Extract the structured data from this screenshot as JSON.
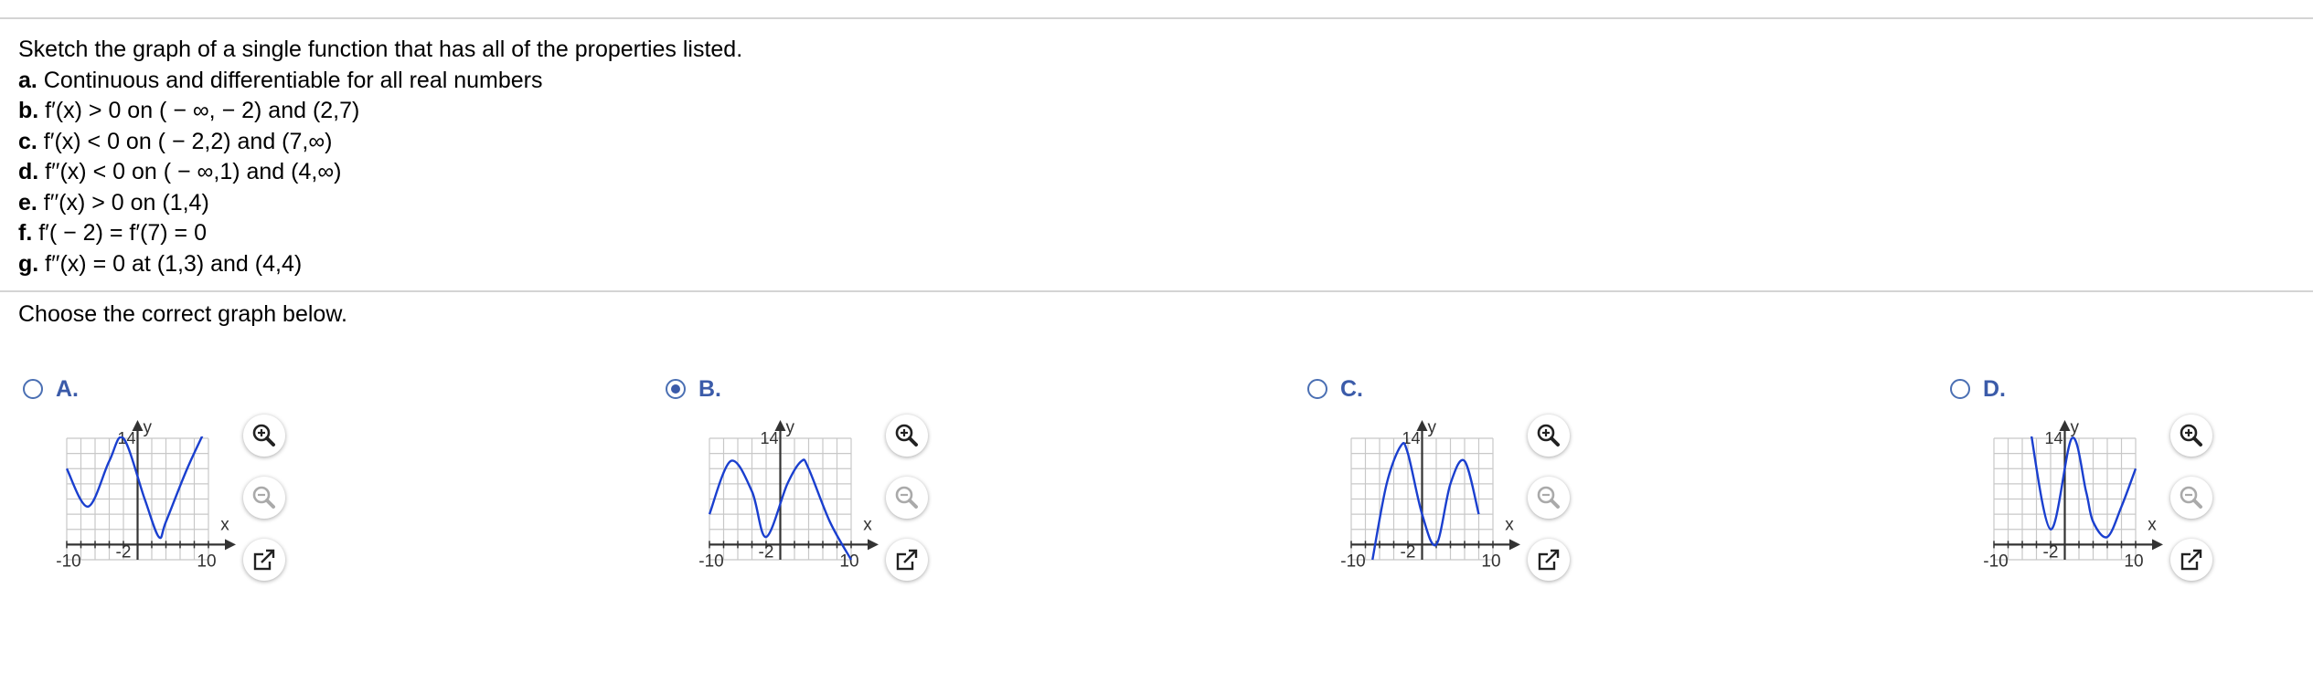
{
  "problem": {
    "intro": "Sketch the graph of a single function that has all of the properties listed.",
    "properties": [
      {
        "label": "a.",
        "text": " Continuous and differentiable for all real numbers"
      },
      {
        "label": "b.",
        "text": " f′(x) > 0 on ( − ∞, − 2) and (2,7)"
      },
      {
        "label": "c.",
        "text": " f′(x) < 0 on ( − 2,2) and (7,∞)"
      },
      {
        "label": "d.",
        "text": " f′′(x) < 0 on ( − ∞,1) and (4,∞)"
      },
      {
        "label": "e.",
        "text": " f′′(x) > 0 on (1,4)"
      },
      {
        "label": "f.",
        "text": " f′( − 2) = f′(7) = 0"
      },
      {
        "label": "g.",
        "text": " f′′(x) = 0 at (1,3) and (4,4)"
      }
    ]
  },
  "prompt": "Choose the correct graph below.",
  "choices": [
    {
      "letter": "A.",
      "selected": false
    },
    {
      "letter": "B.",
      "selected": true
    },
    {
      "letter": "C.",
      "selected": false
    },
    {
      "letter": "D.",
      "selected": false
    }
  ],
  "graph_labels": {
    "y_axis": "y",
    "x_axis": "x",
    "y_max": "14",
    "x_min": "-10",
    "x_tick": "-2",
    "x_max": "10"
  },
  "icons": {
    "zoom_in": "zoom-in-icon",
    "zoom_out": "zoom-out-icon",
    "popout": "popout-icon"
  },
  "colors": {
    "accent": "#3b5ba9",
    "curve": "#1a3fcf",
    "grid": "#c8c8c8"
  },
  "chart_data": [
    {
      "type": "line",
      "choice": "A",
      "xlim": [
        -10,
        10
      ],
      "ylim": [
        -2,
        14
      ],
      "x": [
        -10,
        -7,
        -4,
        -2,
        1,
        3,
        4,
        7,
        10
      ],
      "values": [
        10,
        5,
        11,
        14,
        6,
        1,
        3,
        10,
        16
      ]
    },
    {
      "type": "line",
      "choice": "B",
      "xlim": [
        -10,
        10
      ],
      "ylim": [
        -2,
        14
      ],
      "x": [
        -10,
        -7,
        -4,
        -2,
        1,
        3,
        4,
        7,
        10
      ],
      "values": [
        4,
        11,
        7,
        1,
        8,
        11,
        10,
        3,
        -2
      ]
    },
    {
      "type": "line",
      "choice": "C",
      "xlim": [
        -10,
        10
      ],
      "ylim": [
        -2,
        14
      ],
      "x": [
        -7,
        -5,
        -3,
        -2,
        0,
        2,
        4,
        6,
        8
      ],
      "values": [
        -2,
        8,
        13,
        12,
        4,
        0,
        8,
        11,
        4
      ]
    },
    {
      "type": "line",
      "choice": "D",
      "xlim": [
        -10,
        10
      ],
      "ylim": [
        -2,
        14
      ],
      "x": [
        -5,
        -2,
        1,
        3,
        4,
        6,
        8,
        10
      ],
      "values": [
        16,
        2,
        14,
        7,
        3,
        1,
        5,
        10
      ]
    }
  ]
}
